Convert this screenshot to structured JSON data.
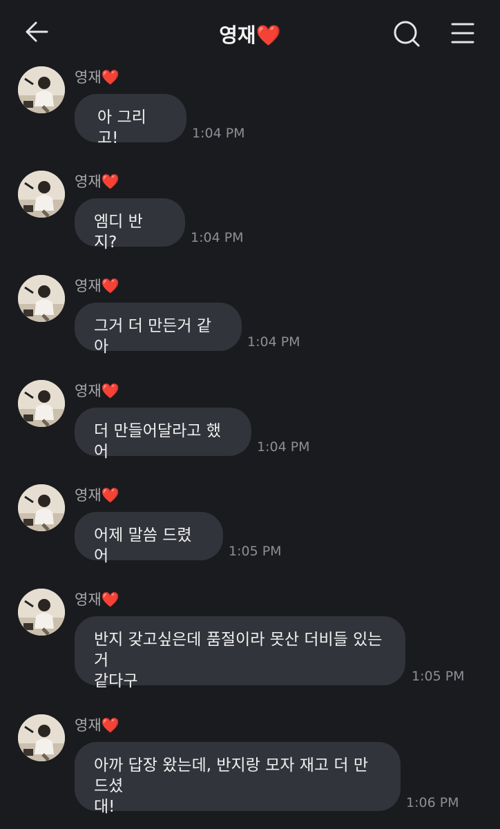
{
  "header": {
    "title": "영재",
    "title_emoji": "❤️"
  },
  "messages": [
    {
      "sender": "영재",
      "sender_emoji": "❤️",
      "text": "아 그리고!",
      "time": "1:04 PM"
    },
    {
      "sender": "영재",
      "sender_emoji": "❤️",
      "text": "엠디 반지?",
      "time": "1:04 PM"
    },
    {
      "sender": "영재",
      "sender_emoji": "❤️",
      "text": "그거 더 만든거 같아",
      "time": "1:04 PM"
    },
    {
      "sender": "영재",
      "sender_emoji": "❤️",
      "text": "더 만들어달라고 했어",
      "time": "1:04 PM"
    },
    {
      "sender": "영재",
      "sender_emoji": "❤️",
      "text": "어제 말씀 드렸어",
      "time": "1:05 PM"
    },
    {
      "sender": "영재",
      "sender_emoji": "❤️",
      "text_lines": [
        "반지 갖고싶은데 품절이라 못산 더비들 있는거",
        "같다구"
      ],
      "time": "1:05 PM"
    },
    {
      "sender": "영재",
      "sender_emoji": "❤️",
      "text_lines": [
        "아까 답장 왔는데, 반지랑 모자 재고 더 만드셨",
        "대!"
      ],
      "time": "1:06 PM"
    }
  ]
}
